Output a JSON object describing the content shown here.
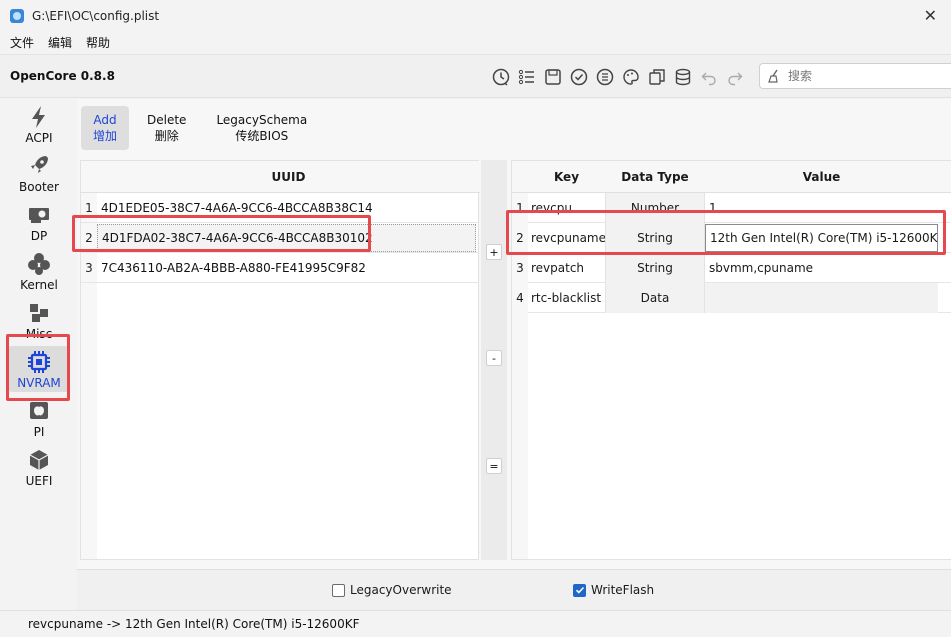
{
  "window": {
    "title": "G:\\EFI\\OC\\config.plist",
    "close_glyph": "✕"
  },
  "menu": [
    "文件",
    "编辑",
    "帮助"
  ],
  "toolbar": {
    "app_name": "OpenCore 0.8.8",
    "icons": [
      "history-icon",
      "list-icon",
      "save-icon",
      "check-icon",
      "list-check-icon",
      "palette-icon",
      "copy-icon",
      "database-icon",
      "undo-icon",
      "redo-icon"
    ],
    "search_placeholder": "搜索"
  },
  "sidebar": {
    "items": [
      {
        "label": "ACPI",
        "icon": "lightning-icon"
      },
      {
        "label": "Booter",
        "icon": "rocket-icon"
      },
      {
        "label": "DP",
        "icon": "graphics-card-icon"
      },
      {
        "label": "Kernel",
        "icon": "puzzle-icon"
      },
      {
        "label": "Misc",
        "icon": "cubes-icon"
      },
      {
        "label": "NVRAM",
        "icon": "chip-icon",
        "active": true
      },
      {
        "label": "PI",
        "icon": "apple-icon"
      },
      {
        "label": "UEFI",
        "icon": "box-icon"
      }
    ]
  },
  "subtabs": [
    {
      "en": "Add",
      "zh": "增加",
      "active": true
    },
    {
      "en": "Delete",
      "zh": "删除"
    },
    {
      "en": "LegacySchema",
      "zh": "传统BIOS"
    }
  ],
  "uuid_table": {
    "header": "UUID",
    "rows": [
      {
        "num": "1",
        "uuid": "4D1EDE05-38C7-4A6A-9CC6-4BCCA8B38C14"
      },
      {
        "num": "2",
        "uuid": "4D1FDA02-38C7-4A6A-9CC6-4BCCA8B30102"
      },
      {
        "num": "3",
        "uuid": "7C436110-AB2A-4BBB-A880-FE41995C9F82"
      }
    ]
  },
  "middle_buttons": {
    "add": "+",
    "remove": "-",
    "equal": "="
  },
  "kv_table": {
    "headers": {
      "key": "Key",
      "type": "Data Type",
      "value": "Value"
    },
    "rows": [
      {
        "num": "1",
        "key": "revcpu",
        "type": "Number",
        "value": "1"
      },
      {
        "num": "2",
        "key": "revcpuname",
        "type": "String",
        "value": "12th Gen Intel(R) Core(TM) i5-12600KF"
      },
      {
        "num": "3",
        "key": "revpatch",
        "type": "String",
        "value": "sbvmm,cpuname"
      },
      {
        "num": "4",
        "key": "rtc-blacklist",
        "type": "Data",
        "value": ""
      }
    ]
  },
  "footer": {
    "legacy_overwrite": {
      "label": "LegacyOverwrite",
      "checked": false
    },
    "write_flash": {
      "label": "WriteFlash",
      "checked": true
    }
  },
  "status": "revcpuname -> 12th Gen Intel(R) Core(TM) i5-12600KF",
  "colors": {
    "accent": "#1f45d6",
    "highlight": "#e5484d",
    "checkbox": "#1f66c7"
  }
}
